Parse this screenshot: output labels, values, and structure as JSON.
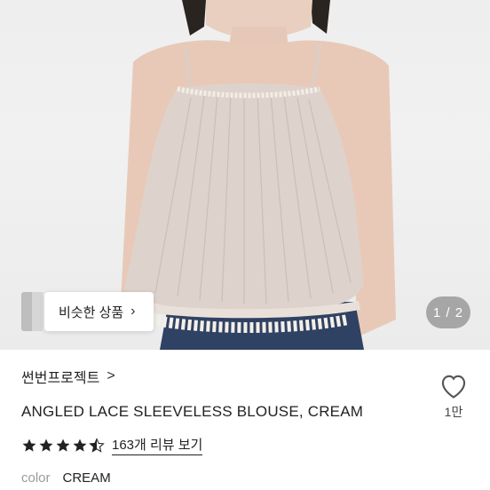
{
  "gallery": {
    "similar_button_label": "비슷한 상품",
    "similar_button_chevron": "›",
    "pager": "1 / 2"
  },
  "product": {
    "shop_name": "썬번프로젝트",
    "shop_chevron": ">",
    "title": "ANGLED LACE SLEEVELESS BLOUSE, CREAM",
    "rating": 4.5,
    "reviews_label": "163개 리뷰 보기",
    "color_label": "color",
    "color_value": "CREAM",
    "like_count": "1만"
  },
  "colors": {
    "star": "#222222",
    "blouse": "#ddd3cc",
    "pager_bg": "#8a8a8a"
  },
  "icons": [
    "heart-outline-icon",
    "star-icon",
    "chevron-right-icon"
  ]
}
